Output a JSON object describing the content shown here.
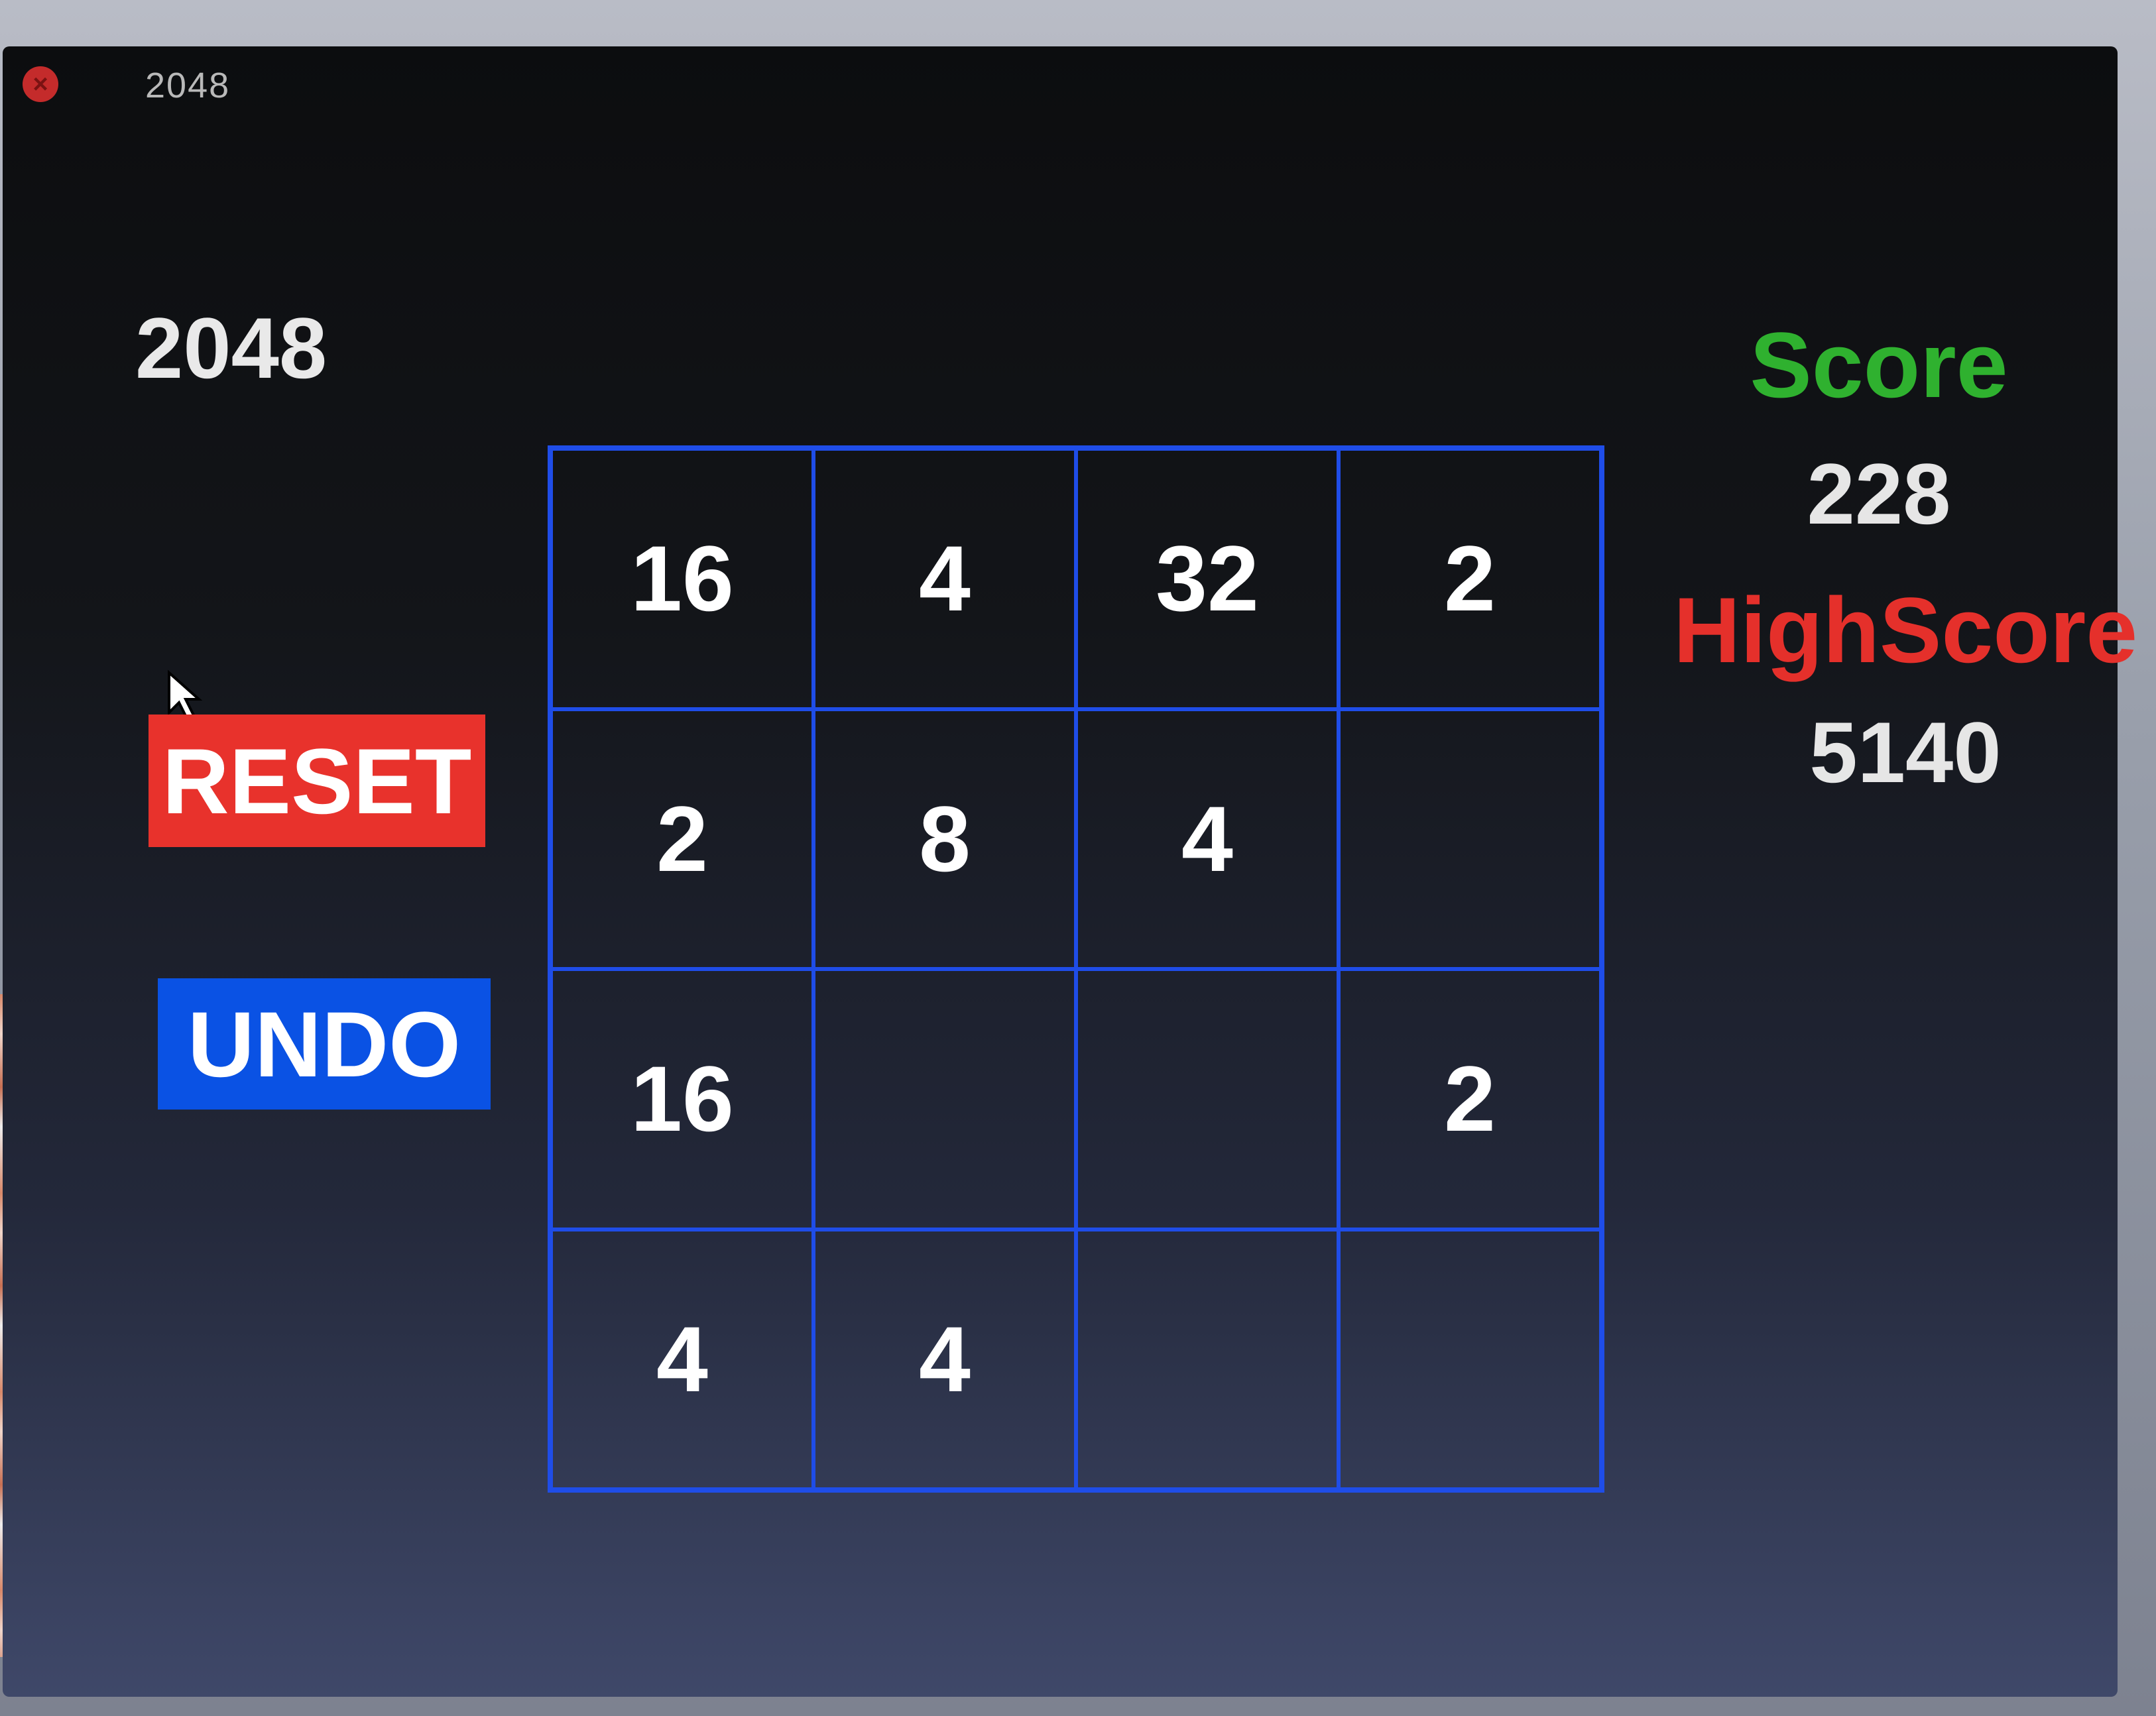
{
  "window": {
    "title": "2048"
  },
  "game": {
    "title": "2048",
    "reset_label": "RESET",
    "undo_label": "UNDO"
  },
  "board": {
    "rows": [
      [
        "16",
        "4",
        "32",
        "2"
      ],
      [
        "2",
        "8",
        "4",
        ""
      ],
      [
        "16",
        "",
        "",
        "2"
      ],
      [
        "4",
        "4",
        "",
        ""
      ]
    ]
  },
  "scoreboard": {
    "score_label": "Score",
    "score_value": "228",
    "highscore_label": "HighScore",
    "highscore_value": "5140"
  },
  "colors": {
    "reset": "#e8322c",
    "undo": "#0a52e4",
    "grid": "#1f4de8",
    "score_label": "#2fb12f",
    "highscore_label": "#e5302b"
  },
  "icons": {
    "close": "close-icon",
    "cursor": "mouse-cursor-icon"
  }
}
